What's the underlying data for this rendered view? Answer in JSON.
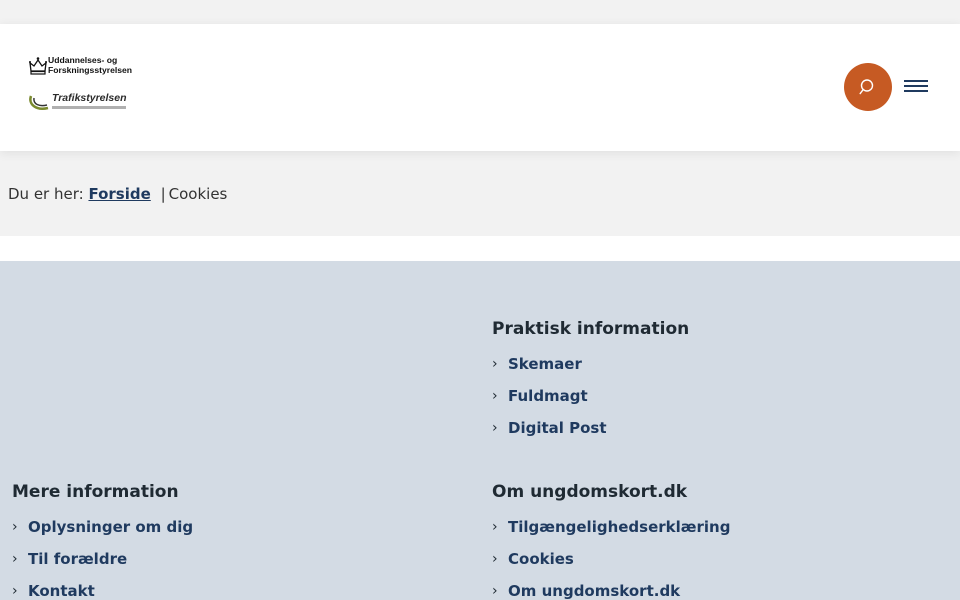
{
  "header": {
    "logo": {
      "ministry_line1": "Uddannelses- og",
      "ministry_line2": "Forskningsstyrelsen",
      "agency": "Trafikstyrelsen"
    },
    "search_icon": "search-icon",
    "menu_icon": "hamburger-menu-icon",
    "accent_color": "#c65a23"
  },
  "breadcrumb": {
    "prefix": "Du er her:",
    "home_label": "Forside",
    "separator": "|",
    "current": "Cookies"
  },
  "footer": {
    "background": "#d3dbe4",
    "sections": [
      {
        "title": "Praktisk information",
        "links": [
          "Skemaer",
          "Fuldmagt",
          "Digital Post"
        ]
      },
      {
        "title": "Mere information",
        "links": [
          "Oplysninger om dig",
          "Til forældre",
          "Kontakt"
        ]
      },
      {
        "title": "Om ungdomskort.dk",
        "links": [
          "Tilgængelighedserklæring",
          "Cookies",
          "Om ungdomskort.dk"
        ]
      }
    ]
  }
}
